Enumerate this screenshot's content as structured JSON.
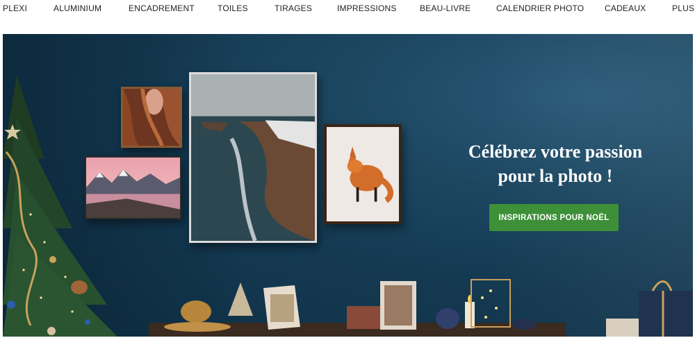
{
  "nav": {
    "items": [
      {
        "label": "PLEXI"
      },
      {
        "label": "ALUMINIUM"
      },
      {
        "label": "ENCADREMENT"
      },
      {
        "label": "TOILES"
      },
      {
        "label": "TIRAGES"
      },
      {
        "label": "IMPRESSIONS"
      },
      {
        "label": "BEAU-LIVRE"
      },
      {
        "label": "CALENDRIER PHOTO"
      },
      {
        "label": "CADEAUX"
      },
      {
        "label": "PLUS"
      }
    ]
  },
  "hero": {
    "headline_line1": "Célébrez votre passion",
    "headline_line2": "pour la photo !",
    "cta_label": "INSPIRATIONS POUR NOËL",
    "colors": {
      "background": "#16405a",
      "cta": "#3d9038",
      "headline": "#ffffff"
    },
    "frames": [
      {
        "subject": "red-hair-portrait-photo"
      },
      {
        "subject": "pink-sky-mountain-lake-photo"
      },
      {
        "subject": "coastal-cliffs-sea-photo"
      },
      {
        "subject": "red-fox-in-snow-photo"
      }
    ]
  }
}
